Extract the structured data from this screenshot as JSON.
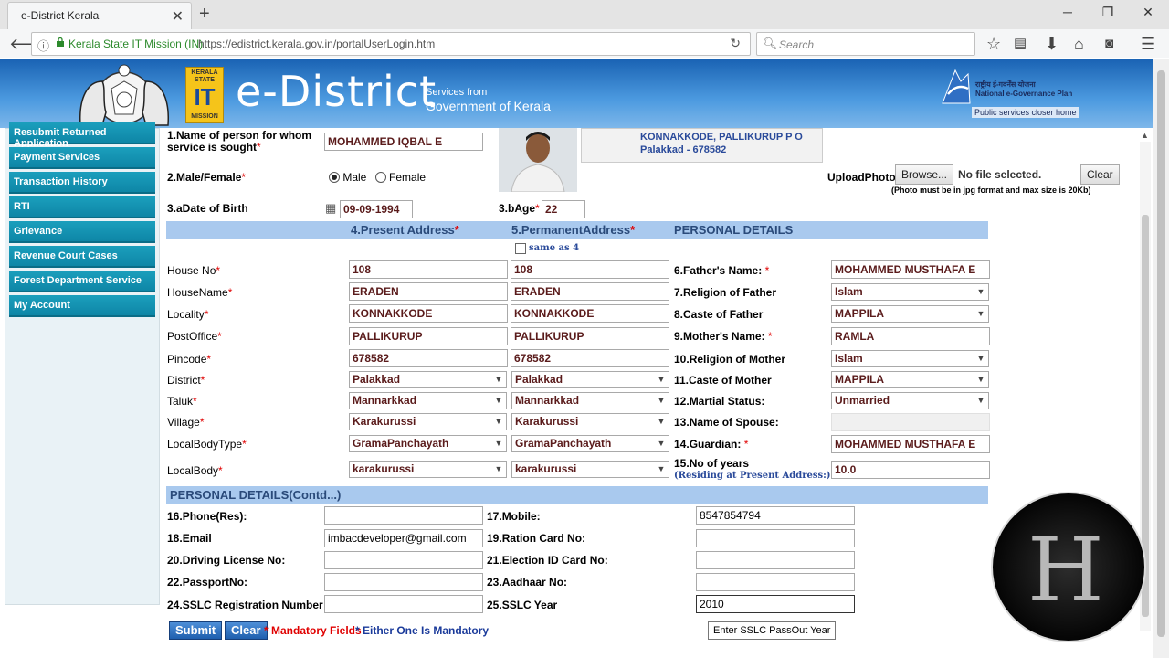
{
  "browser": {
    "tab_title": "e-District Kerala",
    "org_label": "Kerala State IT Mission (IN)",
    "url": "https://edistrict.kerala.gov.in/portalUserLogin.htm",
    "search_placeholder": "Search"
  },
  "banner": {
    "it_logo_lines": [
      "KERALA",
      "STATE",
      "IT",
      "MISSION"
    ],
    "brand": "e-District",
    "services_line1": "Services from",
    "services_line2": "Government of Kerala",
    "nic_line1": "राष्ट्रीय ई-गवर्नेंस योजना",
    "nic_line1b": "National e-Governance Plan",
    "nic_line2": "Public services closer home"
  },
  "sidebar": {
    "items": [
      "Resubmit Returned Application",
      "Payment Services",
      "Transaction History",
      "RTI",
      "Grievance",
      "Revenue Court Cases",
      "Forest Department Service",
      "My Account"
    ]
  },
  "top": {
    "name_label": "1.Name of person for whom service is sought",
    "name_label_l1": "1.Name of person for whom",
    "name_label_l2": "service is sought",
    "name_value": "MOHAMMED IQBAL E",
    "gender_label": "2.Male/Female",
    "gender_male": "Male",
    "gender_female": "Female",
    "dob_label": "3.aDate of Birth",
    "dob_value": "09-09-1994",
    "age_label": "3.bAge",
    "age_value": "22",
    "address_line1": "KONNAKKODE, PALLIKURUP P O",
    "address_line2": "Palakkad - 678582",
    "upload_label": "UploadPhoto",
    "browse_label": "Browse...",
    "no_file": "No file selected.",
    "clear_label": "Clear",
    "photo_note": "(Photo must be in jpg format and max size is 20Kb)"
  },
  "address": {
    "present_header": "4.Present Address",
    "permanent_header": "5.PermanentAddress",
    "personal_header": "PERSONAL DETAILS",
    "same_as": "same as 4",
    "rows": [
      {
        "label": "House No",
        "present": "108",
        "permanent": "108"
      },
      {
        "label": "HouseName",
        "present": "ERADEN",
        "permanent": "ERADEN"
      },
      {
        "label": "Locality",
        "present": "KONNAKKODE",
        "permanent": "KONNAKKODE"
      },
      {
        "label": "PostOffice",
        "present": "PALLIKURUP",
        "permanent": "PALLIKURUP"
      },
      {
        "label": "Pincode",
        "present": "678582",
        "permanent": "678582"
      },
      {
        "label": "District",
        "present": "Palakkad",
        "permanent": "Palakkad"
      },
      {
        "label": "Taluk",
        "present": "Mannarkkad",
        "permanent": "Mannarkkad"
      },
      {
        "label": "Village",
        "present": "Karakurussi",
        "permanent": "Karakurussi"
      },
      {
        "label": "LocalBodyType",
        "present": "GramaPanchayath",
        "permanent": "GramaPanchayath"
      },
      {
        "label": "LocalBody",
        "present": "karakurussi",
        "permanent": "karakurussi"
      }
    ]
  },
  "personal": {
    "rows": [
      {
        "num": "6.",
        "label": "Father's Name:",
        "value": "MOHAMMED MUSTHAFA E"
      },
      {
        "num": "7.",
        "label": "Religion of Father",
        "value": "Islam"
      },
      {
        "num": "8.",
        "label": "Caste of Father",
        "value": "MAPPILA"
      },
      {
        "num": "9.",
        "label": "Mother's Name:",
        "value": "RAMLA"
      },
      {
        "num": "10.",
        "label": "Religion of Mother",
        "value": "Islam"
      },
      {
        "num": "11.",
        "label": "Caste of Mother",
        "value": "MAPPILA"
      },
      {
        "num": "12.",
        "label": "Martial Status:",
        "value": "Unmarried"
      },
      {
        "num": "13.",
        "label": "Name of Spouse:",
        "value": ""
      },
      {
        "num": "14.",
        "label": "Guardian:",
        "value": "MOHAMMED MUSTHAFA E"
      },
      {
        "num": "15.",
        "label": "No of years",
        "sub": "(Residing at Present Address:)",
        "value": "10.0"
      }
    ]
  },
  "contd": {
    "header": "PERSONAL DETAILS(Contd...)",
    "left": [
      {
        "num": "16.",
        "label": "Phone(Res):",
        "value": ""
      },
      {
        "num": "18.",
        "label": "Email",
        "value": "imbacdeveloper@gmail.com"
      },
      {
        "num": "20.",
        "label": "Driving License No:",
        "value": ""
      },
      {
        "num": "22.",
        "label": "PassportNo:",
        "value": ""
      },
      {
        "num": "24.",
        "label": "SSLC Registration Number",
        "value": ""
      }
    ],
    "right": [
      {
        "num": "17.",
        "label": "Mobile:",
        "value": "8547854794"
      },
      {
        "num": "19.",
        "label": "Ration Card No:",
        "value": ""
      },
      {
        "num": "21.",
        "label": "Election ID Card No:",
        "value": ""
      },
      {
        "num": "23.",
        "label": "Aadhaar No:",
        "value": ""
      },
      {
        "num": "25.",
        "label": "SSLC Year",
        "value": "2010"
      }
    ]
  },
  "footer": {
    "submit": "Submit",
    "clear": "Clear",
    "mandatory": "* Mandatory Fields",
    "either": "* Either One Is Mandatory",
    "tooltip": "Enter SSLC PassOut Year"
  },
  "colors": {
    "banner": "#1a63b4",
    "sidebar_item": "#1b9fbd",
    "section_header": "#a9c9ee",
    "value_text": "#5a1b1b",
    "required": "#e00000"
  }
}
